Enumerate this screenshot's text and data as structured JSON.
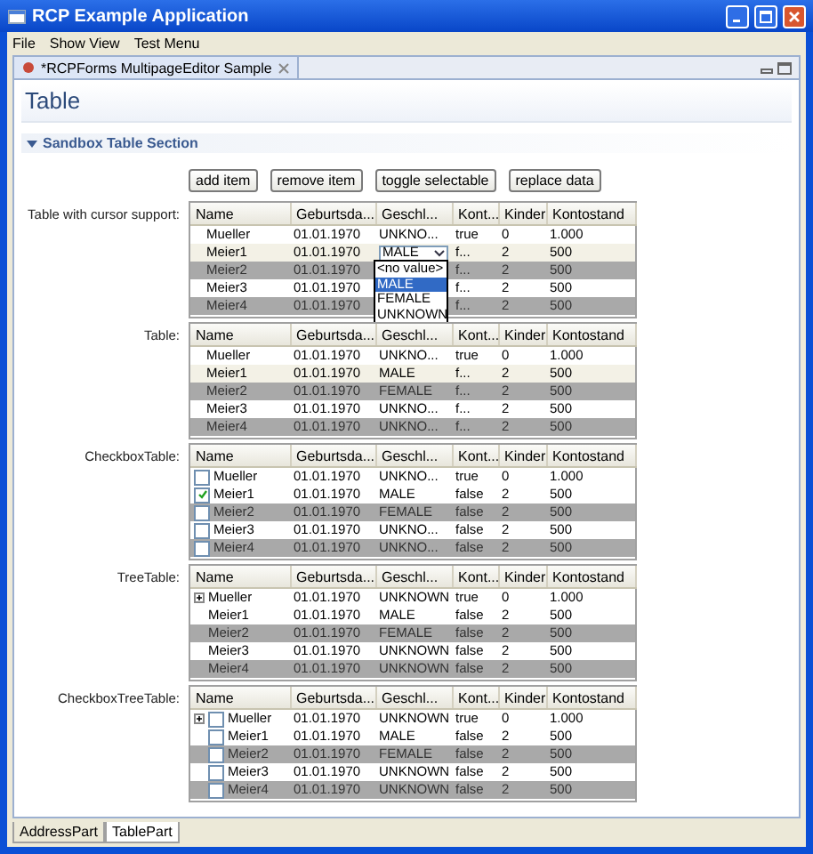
{
  "window": {
    "title": "RCP Example Application"
  },
  "menu": [
    {
      "label": "File"
    },
    {
      "label": "Show View"
    },
    {
      "label": "Test Menu"
    }
  ],
  "editor_tab": {
    "label": "*RCPForms MultipageEditor Sample",
    "selected": true
  },
  "form_title": "Table",
  "section": {
    "title": "Sandbox Table Section",
    "expanded": true
  },
  "buttons": [
    "add item",
    "remove item",
    "toggle selectable",
    "replace data"
  ],
  "tables": [
    {
      "label": "Table with cursor support:",
      "kind": "plain",
      "columns": [
        "Name",
        "Geburtsda...",
        "Geschl...",
        "Kont...",
        "Kinder",
        "Kontostand"
      ],
      "rows": [
        {
          "cells": [
            "Mueller",
            "01.01.1970",
            "UNKNO...",
            "true",
            "0",
            "1.000"
          ],
          "greyed": false,
          "cursor": false
        },
        {
          "cells": [
            "Meier1",
            "01.01.1970",
            "MALE",
            "f...",
            "2",
            "500"
          ],
          "greyed": false,
          "cursor": true,
          "editor": {
            "options": [
              {
                "label": "<no value>",
                "selected": false
              },
              {
                "label": "MALE",
                "selected": true
              },
              {
                "label": "FEMALE",
                "selected": false
              },
              {
                "label": "UNKNOWN",
                "selected": false
              }
            ]
          }
        },
        {
          "cells": [
            "Meier2",
            "01.01.1970",
            "",
            "f...",
            "2",
            "500"
          ],
          "greyed": true,
          "cursor": false
        },
        {
          "cells": [
            "Meier3",
            "01.01.1970",
            "",
            "f...",
            "2",
            "500"
          ],
          "greyed": false,
          "cursor": false
        },
        {
          "cells": [
            "Meier4",
            "01.01.1970",
            "",
            "f...",
            "2",
            "500"
          ],
          "greyed": true,
          "cursor": false
        }
      ]
    },
    {
      "label": "Table:",
      "kind": "plain",
      "columns": [
        "Name",
        "Geburtsda...",
        "Geschl...",
        "Kont...",
        "Kinder",
        "Kontostand"
      ],
      "rows": [
        {
          "cells": [
            "Mueller",
            "01.01.1970",
            "UNKNO...",
            "true",
            "0",
            "1.000"
          ],
          "greyed": false,
          "cursor": false
        },
        {
          "cells": [
            "Meier1",
            "01.01.1970",
            "MALE",
            "f...",
            "2",
            "500"
          ],
          "greyed": false,
          "cursor": true
        },
        {
          "cells": [
            "Meier2",
            "01.01.1970",
            "FEMALE",
            "f...",
            "2",
            "500"
          ],
          "greyed": true,
          "cursor": false
        },
        {
          "cells": [
            "Meier3",
            "01.01.1970",
            "UNKNO...",
            "f...",
            "2",
            "500"
          ],
          "greyed": false,
          "cursor": false
        },
        {
          "cells": [
            "Meier4",
            "01.01.1970",
            "UNKNO...",
            "f...",
            "2",
            "500"
          ],
          "greyed": true,
          "cursor": false
        }
      ]
    },
    {
      "label": "CheckboxTable:",
      "kind": "checkbox",
      "columns": [
        "Name",
        "Geburtsda...",
        "Geschl...",
        "Kont...",
        "Kinder",
        "Kontostand"
      ],
      "rows": [
        {
          "cells": [
            "Mueller",
            "01.01.1970",
            "UNKNO...",
            "true",
            "0",
            "1.000"
          ],
          "greyed": false,
          "cursor": false,
          "checked": false
        },
        {
          "cells": [
            "Meier1",
            "01.01.1970",
            "MALE",
            "false",
            "2",
            "500"
          ],
          "greyed": false,
          "cursor": false,
          "checked": true
        },
        {
          "cells": [
            "Meier2",
            "01.01.1970",
            "FEMALE",
            "false",
            "2",
            "500"
          ],
          "greyed": true,
          "cursor": false,
          "checked": false
        },
        {
          "cells": [
            "Meier3",
            "01.01.1970",
            "UNKNO...",
            "false",
            "2",
            "500"
          ],
          "greyed": false,
          "cursor": false,
          "checked": false
        },
        {
          "cells": [
            "Meier4",
            "01.01.1970",
            "UNKNO...",
            "false",
            "2",
            "500"
          ],
          "greyed": true,
          "cursor": false,
          "checked": false
        }
      ]
    },
    {
      "label": "TreeTable:",
      "kind": "tree",
      "columns": [
        "Name",
        "Geburtsda...",
        "Geschl...",
        "Kont...",
        "Kinder",
        "Kontostand"
      ],
      "rows": [
        {
          "cells": [
            "Mueller",
            "01.01.1970",
            "UNKNOWN",
            "true",
            "0",
            "1.000"
          ],
          "greyed": false,
          "cursor": false,
          "expandable": true
        },
        {
          "cells": [
            "Meier1",
            "01.01.1970",
            "MALE",
            "false",
            "2",
            "500"
          ],
          "greyed": false,
          "cursor": false,
          "expandable": false
        },
        {
          "cells": [
            "Meier2",
            "01.01.1970",
            "FEMALE",
            "false",
            "2",
            "500"
          ],
          "greyed": true,
          "cursor": false,
          "expandable": false
        },
        {
          "cells": [
            "Meier3",
            "01.01.1970",
            "UNKNOWN",
            "false",
            "2",
            "500"
          ],
          "greyed": false,
          "cursor": false,
          "expandable": false
        },
        {
          "cells": [
            "Meier4",
            "01.01.1970",
            "UNKNOWN",
            "false",
            "2",
            "500"
          ],
          "greyed": true,
          "cursor": false,
          "expandable": false
        }
      ]
    },
    {
      "label": "CheckboxTreeTable:",
      "kind": "checkbox_tree",
      "columns": [
        "Name",
        "Geburtsda...",
        "Geschl...",
        "Kont...",
        "Kinder",
        "Kontostand"
      ],
      "rows": [
        {
          "cells": [
            "Mueller",
            "01.01.1970",
            "UNKNOWN",
            "true",
            "0",
            "1.000"
          ],
          "greyed": false,
          "cursor": false,
          "checked": false,
          "expandable": true
        },
        {
          "cells": [
            "Meier1",
            "01.01.1970",
            "MALE",
            "false",
            "2",
            "500"
          ],
          "greyed": false,
          "cursor": false,
          "checked": false,
          "expandable": false
        },
        {
          "cells": [
            "Meier2",
            "01.01.1970",
            "FEMALE",
            "false",
            "2",
            "500"
          ],
          "greyed": true,
          "cursor": false,
          "checked": false,
          "expandable": false
        },
        {
          "cells": [
            "Meier3",
            "01.01.1970",
            "UNKNOWN",
            "false",
            "2",
            "500"
          ],
          "greyed": false,
          "cursor": false,
          "checked": false,
          "expandable": false
        },
        {
          "cells": [
            "Meier4",
            "01.01.1970",
            "UNKNOWN",
            "false",
            "2",
            "500"
          ],
          "greyed": true,
          "cursor": false,
          "checked": false,
          "expandable": false
        }
      ]
    }
  ],
  "bottom_tabs": [
    {
      "label": "AddressPart",
      "selected": false
    },
    {
      "label": "TablePart",
      "selected": true
    }
  ]
}
